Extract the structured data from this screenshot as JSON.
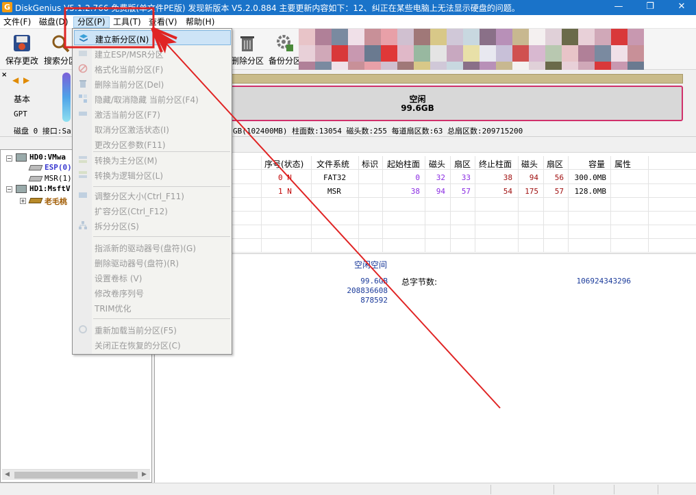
{
  "window": {
    "title": "DiskGenius V5.1.2.766 免费版(单文件PE版)  发现新版本 V5.2.0.884 主要更新内容如下：12、纠正在某些电脑上无法显示硬盘的问题。",
    "app_icon_letter": "G",
    "minimize": "—",
    "restore": "❐",
    "close": "✕"
  },
  "menubar": {
    "items": [
      {
        "label": "文件(F)"
      },
      {
        "label": "磁盘(D)"
      },
      {
        "label": "分区(P)"
      },
      {
        "label": "工具(T)"
      },
      {
        "label": "查看(V)"
      },
      {
        "label": "帮助(H)"
      }
    ]
  },
  "toolbar": {
    "save_label": "保存更改",
    "search_label": "搜索分区",
    "delete_label": "删除分区",
    "backup_label": "备份分区"
  },
  "disk_info": {
    "nav_left": "◀",
    "nav_right": "▶",
    "type_label": "基本",
    "style_label": "GPT",
    "iface_text": "磁盘 0 接口:Sa",
    "summary": "GB(102400MB)  柱面数:13054  磁头数:255  每道扇区数:63  总扇区数:209715200",
    "free_label": "空闲",
    "free_size": "99.6GB"
  },
  "tree": {
    "hd0": "HD0:VMwa",
    "esp": "ESP(0)",
    "msr": "MSR(1)",
    "hd1": "HD1:MsftV",
    "laomao": "老毛桃"
  },
  "partition_table": {
    "headers": [
      "序号(状态)",
      "文件系统",
      "标识",
      "起始柱面",
      "磁头",
      "扇区",
      "终止柱面",
      "磁头",
      "扇区",
      "容量",
      "属性"
    ],
    "rows": [
      [
        "0 N",
        "FAT32",
        "",
        "0",
        "32",
        "33",
        "38",
        "94",
        "56",
        "300.0MB",
        ""
      ],
      [
        "1 N",
        "MSR",
        "",
        "38",
        "94",
        "57",
        "54",
        "175",
        "57",
        "128.0MB",
        ""
      ]
    ]
  },
  "details": {
    "free_space_label": "空闲空间",
    "size_value": "99.6GB",
    "total_bytes_label": "总字节数:",
    "total_bytes_value": "106924343296",
    "value2": "208836608",
    "value3": "878592"
  },
  "dropdown": {
    "items": [
      {
        "label": "建立新分区(N)",
        "enabled": true
      },
      {
        "label": "建立ESP/MSR分区",
        "enabled": false
      },
      {
        "label": "格式化当前分区(F)",
        "enabled": false
      },
      {
        "label": "删除当前分区(Del)",
        "enabled": false
      },
      {
        "label": "隐藏/取消隐藏 当前分区(F4)",
        "enabled": false
      },
      {
        "label": "激活当前分区(F7)",
        "enabled": false
      },
      {
        "label": "取消分区激活状态(I)",
        "enabled": false
      },
      {
        "label": "更改分区参数(F11)",
        "enabled": false
      },
      {
        "label": "转换为主分区(M)",
        "enabled": false
      },
      {
        "label": "转换为逻辑分区(L)",
        "enabled": false
      },
      {
        "label": "调整分区大小(Ctrl_F11)",
        "enabled": false
      },
      {
        "label": "扩容分区(Ctrl_F12)",
        "enabled": false
      },
      {
        "label": "拆分分区(S)",
        "enabled": false
      },
      {
        "label": "指派新的驱动器号(盘符)(G)",
        "enabled": false
      },
      {
        "label": "删除驱动器号(盘符)(R)",
        "enabled": false
      },
      {
        "label": "设置卷标 (V)",
        "enabled": false
      },
      {
        "label": "修改卷序列号",
        "enabled": false
      },
      {
        "label": "TRIM优化",
        "enabled": false
      },
      {
        "label": "重新加载当前分区(F5)",
        "enabled": false
      },
      {
        "label": "关闭正在恢复的分区(C)",
        "enabled": false
      }
    ]
  },
  "colors": {
    "titlebar": "#1a73c9",
    "annotation_red": "#e02424",
    "free_bar_border": "#d0306a"
  }
}
